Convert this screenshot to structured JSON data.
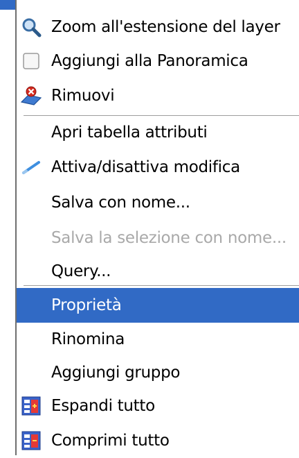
{
  "menu": {
    "items": [
      {
        "label": "Zoom all'estensione del layer",
        "icon": "zoom-icon"
      },
      {
        "label": "Aggiungi alla Panoramica",
        "icon": "checkbox-icon",
        "checked": false
      },
      {
        "label": "Rimuovi",
        "icon": "remove-layer-icon"
      },
      {
        "label": "Apri tabella attributi"
      },
      {
        "label": "Attiva/disattiva modifica",
        "icon": "pencil-icon"
      },
      {
        "label": "Salva con nome..."
      },
      {
        "label": "Salva la selezione con nome...",
        "disabled": true
      },
      {
        "label": "Query..."
      },
      {
        "label": "Proprietà",
        "selected": true
      },
      {
        "label": "Rinomina"
      },
      {
        "label": "Aggiungi gruppo"
      },
      {
        "label": "Espandi tutto",
        "icon": "expand-all-icon"
      },
      {
        "label": "Comprimi tutto",
        "icon": "collapse-all-icon"
      }
    ]
  },
  "colors": {
    "selection": "#316ac5",
    "disabled_text": "#a9a9a9"
  }
}
